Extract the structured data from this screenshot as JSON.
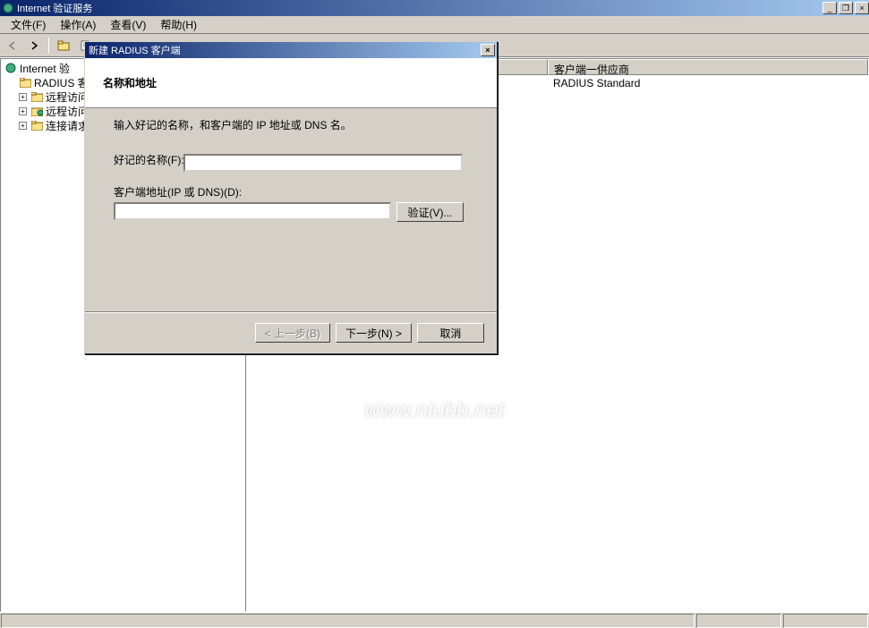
{
  "window": {
    "title": "Internet 验证服务",
    "minimize": "_",
    "restore": "❐",
    "close": "×"
  },
  "menu": {
    "file": "文件(F)",
    "action": "操作(A)",
    "view": "查看(V)",
    "help": "帮助(H)"
  },
  "toolbar": {
    "back": "←",
    "forward": "→",
    "up": "📁",
    "props": "📋"
  },
  "tree": {
    "root": "Internet 验",
    "radius": "RADIUS 客",
    "remote1": "远程访问",
    "remote2": "远程访问",
    "conn": "连接请求"
  },
  "list": {
    "col_name": "",
    "col_vendor": "客户端一供应商",
    "row1_name": "",
    "row1_vendor": "RADIUS Standard"
  },
  "dialog": {
    "title": "新建 RADIUS 客户端",
    "header": "名称和地址",
    "hint": "输入好记的名称，和客户端的 IP 地址或 DNS 名。",
    "friendly_label": "好记的名称(F):",
    "address_label": "客户端地址(IP 或 DNS)(D):",
    "verify": "验证(V)...",
    "back": "< 上一步(B)",
    "next": "下一步(N) >",
    "cancel": "取消",
    "close": "×"
  },
  "watermark": "www.niubb.net"
}
